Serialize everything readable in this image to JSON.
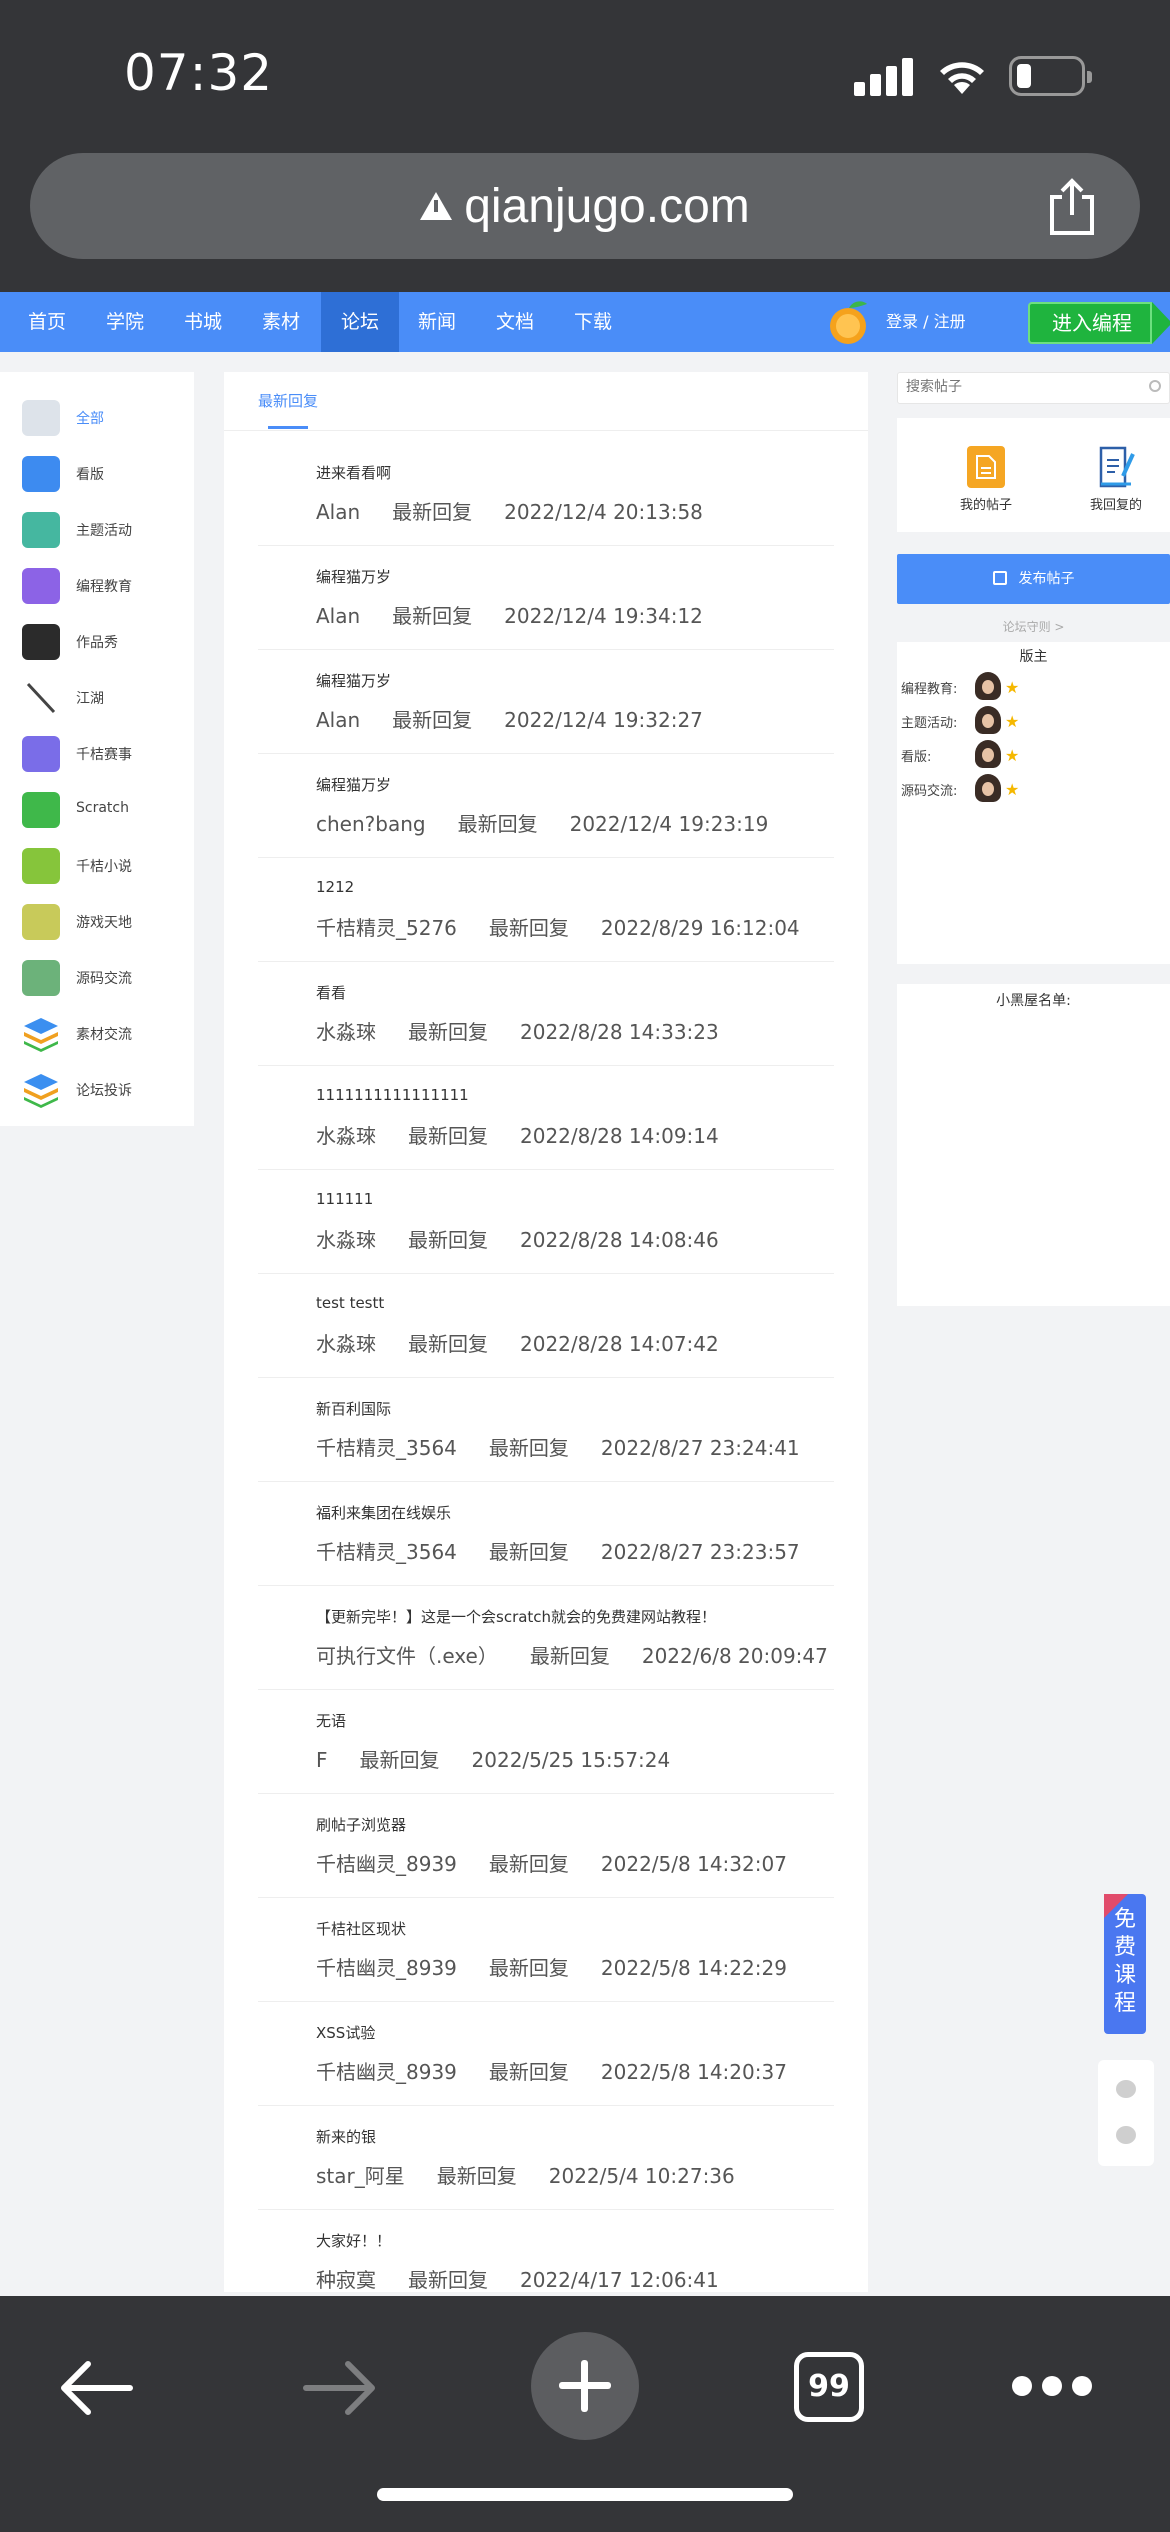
{
  "status": {
    "time": "07:32"
  },
  "browser": {
    "url": "qianjugo.com",
    "tab_count": "99"
  },
  "nav": {
    "items": [
      "首页",
      "学院",
      "书城",
      "素材",
      "论坛",
      "新闻",
      "文档",
      "下载"
    ],
    "active_index": 4,
    "login": "登录 / 注册",
    "cta": "进入编程"
  },
  "sidebar": {
    "items": [
      {
        "label": "全部",
        "icon": "newspaper-icon",
        "color": "#dde3ea",
        "active": true
      },
      {
        "label": "看版",
        "icon": "board-icon",
        "color": "#3d8bf0"
      },
      {
        "label": "主题活动",
        "icon": "target-icon",
        "color": "#45b7a0"
      },
      {
        "label": "编程教育",
        "icon": "chart-icon",
        "color": "#8c63e6"
      },
      {
        "label": "作品秀",
        "icon": "house-icon",
        "color": "#2b2b2b"
      },
      {
        "label": "江湖",
        "icon": "sword-icon",
        "color": "#ffffff"
      },
      {
        "label": "千桔赛事",
        "icon": "trophy-icon",
        "color": "#7a6de8"
      },
      {
        "label": "Scratch",
        "icon": "scratch-cat-icon",
        "color": "#3fb84a"
      },
      {
        "label": "千桔小说",
        "icon": "book-icon",
        "color": "#86c53b"
      },
      {
        "label": "游戏天地",
        "icon": "gamepad-icon",
        "color": "#c8ca5a"
      },
      {
        "label": "源码交流",
        "icon": "code-icon",
        "color": "#6cb27a"
      },
      {
        "label": "素材交流",
        "icon": "layers-icon",
        "color": "#3b8ff0"
      },
      {
        "label": "论坛投诉",
        "icon": "layers-icon",
        "color": "#3b8ff0"
      }
    ]
  },
  "main": {
    "tab": "最新回复",
    "reply_label": "最新回复",
    "posts": [
      {
        "title": "进来看看啊",
        "user": "Alan",
        "time": "2022/12/4 20:13:58"
      },
      {
        "title": "编程猫万岁",
        "user": "Alan",
        "time": "2022/12/4 19:34:12"
      },
      {
        "title": "编程猫万岁",
        "user": "Alan",
        "time": "2022/12/4 19:32:27"
      },
      {
        "title": "编程猫万岁",
        "user": "chen?bang",
        "time": "2022/12/4 19:23:19"
      },
      {
        "title": "1212",
        "user": "千桔精灵_5276",
        "time": "2022/8/29 16:12:04"
      },
      {
        "title": "看看",
        "user": "水淼琜",
        "time": "2022/8/28 14:33:23"
      },
      {
        "title": "1111111111111111",
        "user": "水淼琜",
        "time": "2022/8/28 14:09:14"
      },
      {
        "title": "111111",
        "user": "水淼琜",
        "time": "2022/8/28 14:08:46"
      },
      {
        "title": "test testt",
        "user": "水淼琜",
        "time": "2022/8/28 14:07:42"
      },
      {
        "title": "新百利国际",
        "user": "千桔精灵_3564",
        "time": "2022/8/27 23:24:41"
      },
      {
        "title": "福利来集团在线娱乐",
        "user": "千桔精灵_3564",
        "time": "2022/8/27 23:23:57"
      },
      {
        "title": "【更新完毕！】这是一个会scratch就会的免费建网站教程！",
        "user": "可执行文件（.exe）",
        "time": "2022/6/8 20:09:47"
      },
      {
        "title": "无语",
        "user": "F",
        "time": "2022/5/25 15:57:24"
      },
      {
        "title": "刷帖子浏览器",
        "user": "千桔幽灵_8939",
        "time": "2022/5/8 14:32:07"
      },
      {
        "title": "千桔社区现状",
        "user": "千桔幽灵_8939",
        "time": "2022/5/8 14:22:29"
      },
      {
        "title": "XSS试验",
        "user": "千桔幽灵_8939",
        "time": "2022/5/8 14:20:37"
      },
      {
        "title": "新来的银",
        "user": "star_阿星",
        "time": "2022/5/4 10:27:36"
      },
      {
        "title": "大家好！！",
        "user": "种寂寞",
        "time": "2022/4/17 12:06:41"
      }
    ]
  },
  "right": {
    "search_placeholder": "搜索帖子",
    "my_posts": "我的帖子",
    "my_replies": "我回复的",
    "publish": "发布帖子",
    "guard_link": "论坛守则 >",
    "moderators_title": "版主",
    "moderators": [
      "编程教育:",
      "主题活动:",
      "看版:",
      "源码交流:"
    ],
    "blacklist_title": "小黑屋名单:"
  },
  "float": {
    "course": "免费课程"
  }
}
